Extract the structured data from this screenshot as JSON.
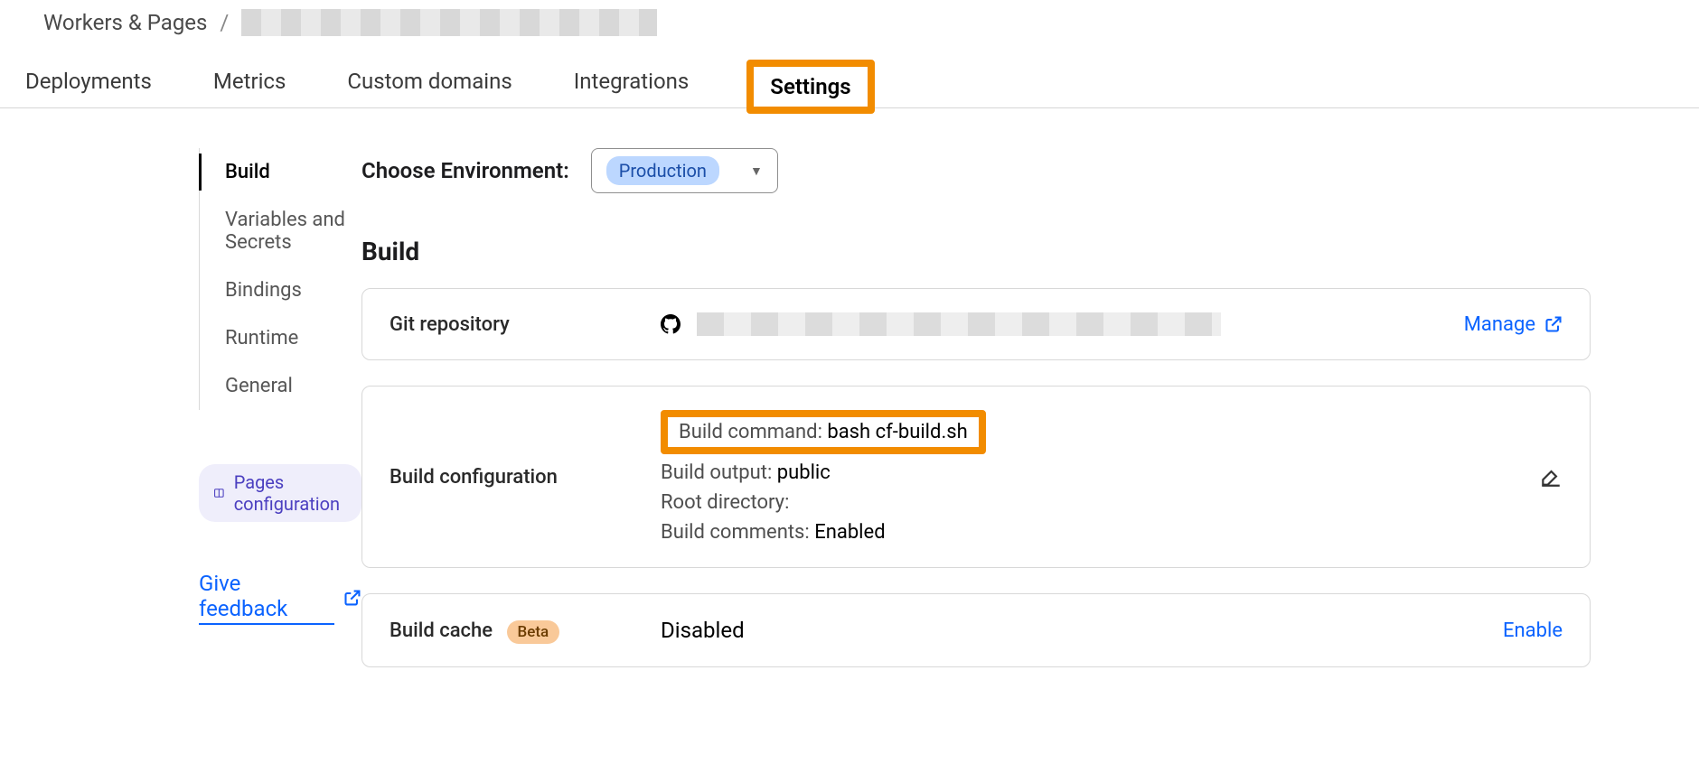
{
  "breadcrumb": {
    "root": "Workers & Pages",
    "separator": "/"
  },
  "tabs": {
    "deployments": "Deployments",
    "metrics": "Metrics",
    "custom_domains": "Custom domains",
    "integrations": "Integrations",
    "settings": "Settings"
  },
  "sidebar": {
    "build": "Build",
    "variables": "Variables and Secrets",
    "bindings": "Bindings",
    "runtime": "Runtime",
    "general": "General",
    "pages_config": "Pages configuration",
    "feedback": "Give feedback"
  },
  "env": {
    "label": "Choose Environment:",
    "selected": "Production"
  },
  "section": {
    "title": "Build"
  },
  "git_card": {
    "label": "Git repository",
    "manage": "Manage"
  },
  "build_config": {
    "label": "Build configuration",
    "build_command_key": "Build command: ",
    "build_command_val": "bash cf-build.sh",
    "build_output_key": "Build output: ",
    "build_output_val": "public",
    "root_dir_key": "Root directory:",
    "root_dir_val": "",
    "comments_key": "Build comments: ",
    "comments_val": "Enabled"
  },
  "build_cache": {
    "label": "Build cache",
    "badge": "Beta",
    "value": "Disabled",
    "action": "Enable"
  }
}
